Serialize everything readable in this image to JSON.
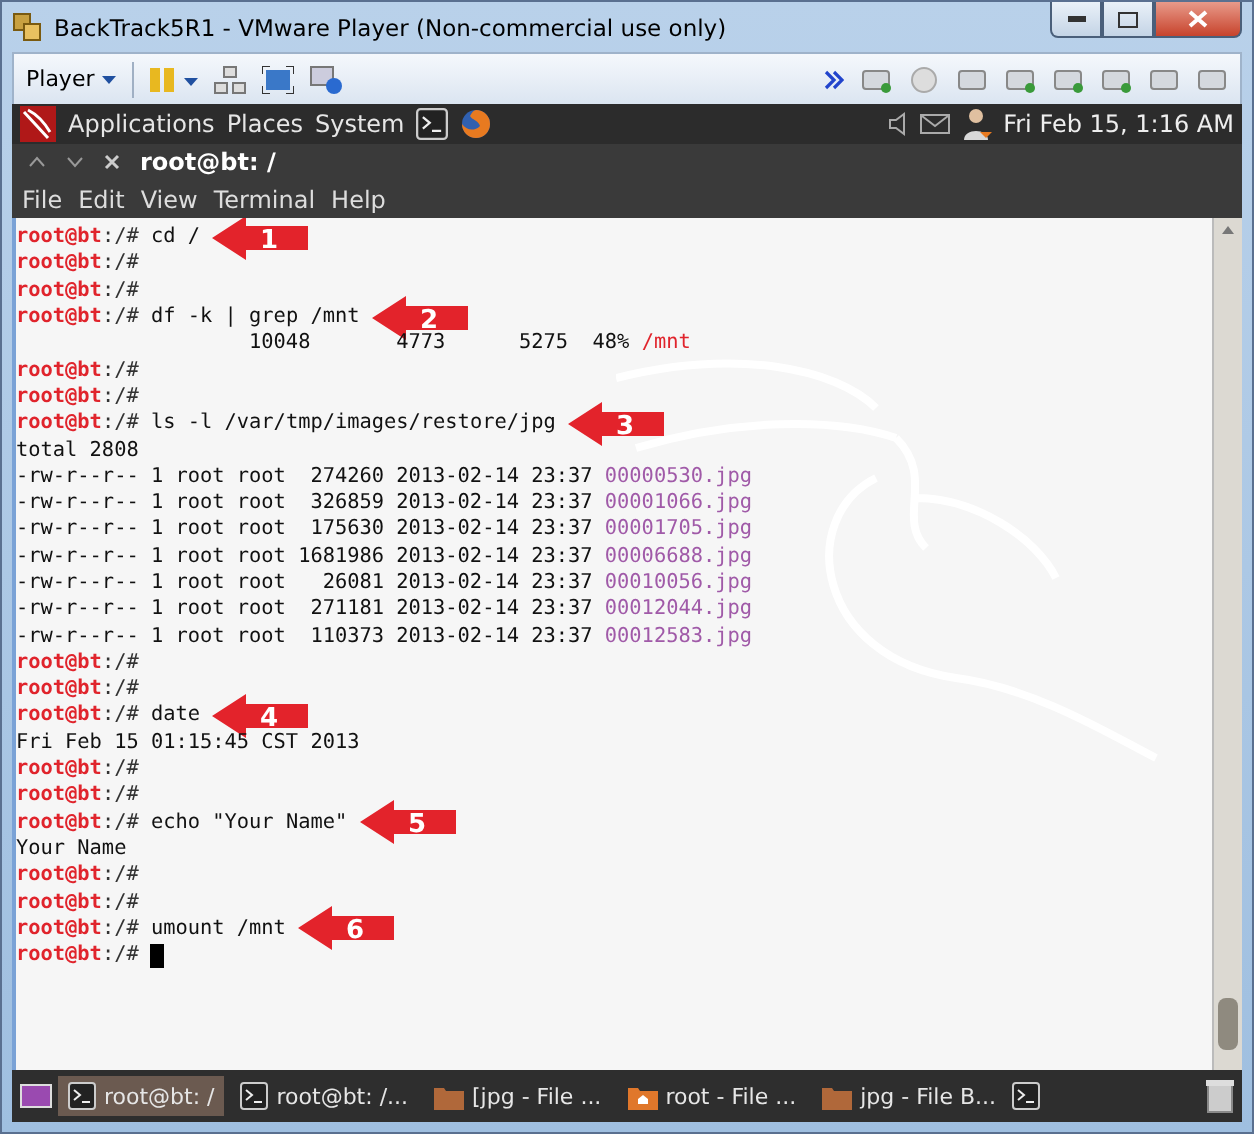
{
  "window": {
    "title": "BackTrack5R1 - VMware Player (Non-commercial use only)"
  },
  "player_toolbar": {
    "menu": "Player"
  },
  "gnome_panel": {
    "menus": [
      "Applications",
      "Places",
      "System"
    ],
    "clock": "Fri Feb 15,  1:16 AM"
  },
  "terminal": {
    "title": "root@bt: /",
    "menus": [
      "File",
      "Edit",
      "View",
      "Terminal",
      "Help"
    ],
    "lines": [
      {
        "kind": "prompt",
        "user": "root@bt",
        "path": ":/#",
        "command": "cd /",
        "callout": "1"
      },
      {
        "kind": "prompt",
        "user": "root@bt",
        "path": ":/#"
      },
      {
        "kind": "prompt",
        "user": "root@bt",
        "path": ":/#"
      },
      {
        "kind": "prompt",
        "user": "root@bt",
        "path": ":/#",
        "command": "df -k | grep /mnt",
        "callout": "2"
      },
      {
        "kind": "df",
        "text": "                   10048       4773      5275  48% ",
        "mount": "/mnt"
      },
      {
        "kind": "prompt",
        "user": "root@bt",
        "path": ":/#"
      },
      {
        "kind": "prompt",
        "user": "root@bt",
        "path": ":/#"
      },
      {
        "kind": "prompt",
        "user": "root@bt",
        "path": ":/#",
        "command": "ls -l /var/tmp/images/restore/jpg",
        "callout": "3"
      },
      {
        "kind": "output",
        "text": "total 2808"
      },
      {
        "kind": "file",
        "info": "-rw-r--r-- 1 root root  274260 2013-02-14 23:37 ",
        "name": "00000530.jpg"
      },
      {
        "kind": "file",
        "info": "-rw-r--r-- 1 root root  326859 2013-02-14 23:37 ",
        "name": "00001066.jpg"
      },
      {
        "kind": "file",
        "info": "-rw-r--r-- 1 root root  175630 2013-02-14 23:37 ",
        "name": "00001705.jpg"
      },
      {
        "kind": "file",
        "info": "-rw-r--r-- 1 root root 1681986 2013-02-14 23:37 ",
        "name": "00006688.jpg"
      },
      {
        "kind": "file",
        "info": "-rw-r--r-- 1 root root   26081 2013-02-14 23:37 ",
        "name": "00010056.jpg"
      },
      {
        "kind": "file",
        "info": "-rw-r--r-- 1 root root  271181 2013-02-14 23:37 ",
        "name": "00012044.jpg"
      },
      {
        "kind": "file",
        "info": "-rw-r--r-- 1 root root  110373 2013-02-14 23:37 ",
        "name": "00012583.jpg"
      },
      {
        "kind": "prompt",
        "user": "root@bt",
        "path": ":/#"
      },
      {
        "kind": "prompt",
        "user": "root@bt",
        "path": ":/#"
      },
      {
        "kind": "prompt",
        "user": "root@bt",
        "path": ":/#",
        "command": "date",
        "callout": "4"
      },
      {
        "kind": "output",
        "text": "Fri Feb 15 01:15:45 CST 2013"
      },
      {
        "kind": "prompt",
        "user": "root@bt",
        "path": ":/#"
      },
      {
        "kind": "prompt",
        "user": "root@bt",
        "path": ":/#"
      },
      {
        "kind": "prompt",
        "user": "root@bt",
        "path": ":/#",
        "command": "echo \"Your Name\"",
        "callout": "5"
      },
      {
        "kind": "output",
        "text": "Your Name"
      },
      {
        "kind": "prompt",
        "user": "root@bt",
        "path": ":/#"
      },
      {
        "kind": "prompt",
        "user": "root@bt",
        "path": ":/#"
      },
      {
        "kind": "prompt",
        "user": "root@bt",
        "path": ":/#",
        "command": "umount /mnt",
        "callout": "6"
      },
      {
        "kind": "prompt",
        "user": "root@bt",
        "path": ":/#",
        "cursor": true
      }
    ]
  },
  "taskbar": {
    "items": [
      {
        "label": "root@bt: /",
        "kind": "terminal",
        "selected": true
      },
      {
        "label": "root@bt: /...",
        "kind": "terminal",
        "selected": false
      },
      {
        "label": "[jpg - File ...",
        "kind": "folder",
        "selected": false
      },
      {
        "label": "root - File ...",
        "kind": "home",
        "selected": false
      },
      {
        "label": "jpg - File B...",
        "kind": "folder",
        "selected": false
      }
    ]
  }
}
